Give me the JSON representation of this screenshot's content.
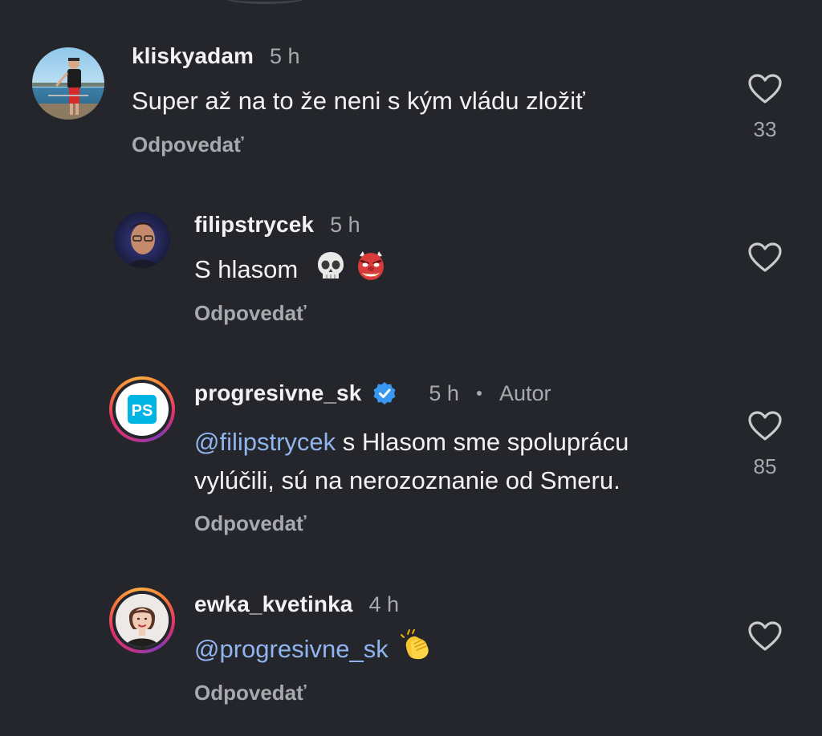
{
  "colors": {
    "background": "#25262b",
    "text": "#f2f2f2",
    "secondary": "#a8a9ae",
    "mention": "#8fb4ee",
    "verified": "#3897f0"
  },
  "comments": [
    {
      "username": "kliskyadam",
      "time": "5 h",
      "text": "Super až na to že neni s kým vládu zložiť",
      "reply": "Odpovedať",
      "likes": "33",
      "avatar_icon": "profile-photo"
    },
    {
      "username": "filipstrycek",
      "time": "5 h",
      "text": "S hlasom",
      "emojis": [
        "skull-emoji",
        "goblin-emoji"
      ],
      "reply": "Odpovedať",
      "likes": "",
      "avatar_icon": "profile-photo"
    },
    {
      "username": "progresivne_sk",
      "time": "5 h",
      "author_label": "Autor",
      "verified": true,
      "mention": "@filipstrycek",
      "text_line1": " s Hlasom sme spoluprácu",
      "text_line2": "vylúčili, sú na nerozoznanie od Smeru.",
      "reply": "Odpovedať",
      "likes": "85",
      "avatar_text": "PS"
    },
    {
      "username": "ewka_kvetinka",
      "time": "4 h",
      "mention": "@progresivne_sk",
      "emojis": [
        "clapping-hands-emoji"
      ],
      "reply": "Odpovedať",
      "likes": "",
      "avatar_icon": "profile-photo"
    }
  ]
}
